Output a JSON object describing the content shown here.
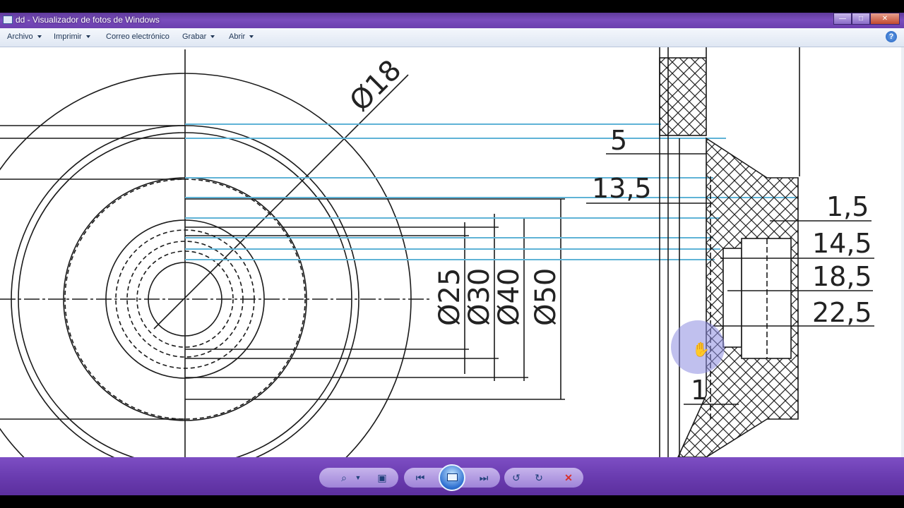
{
  "window": {
    "title": "dd - Visualizador de fotos de Windows"
  },
  "menu": {
    "archivo": "Archivo",
    "imprimir": "Imprimir",
    "correo": "Correo electrónico",
    "grabar": "Grabar",
    "abrir": "Abrir",
    "help": "?"
  },
  "drawing": {
    "dims": {
      "d18": "18",
      "d25": "25",
      "d30": "30",
      "d40": "40",
      "d50": "50",
      "v5": "5",
      "v13_5": "13,5",
      "v1_5": "1,5",
      "v14_5": "14,5",
      "v18_5": "18,5",
      "v22_5": "22,5",
      "v1": "1"
    },
    "diameter_symbol": "Ø"
  },
  "toolbar": {
    "icons": [
      "zoom-icon",
      "actual-size-icon",
      "previous-icon",
      "slideshow-icon",
      "next-icon",
      "rotate-left-icon",
      "rotate-right-icon",
      "delete-icon"
    ]
  },
  "colors": {
    "accent": "#6b3fae",
    "projection_lines": "#5fb3d6",
    "drawing_lines": "#1a1a1a",
    "cursor_highlight": "#8c8ce0"
  }
}
